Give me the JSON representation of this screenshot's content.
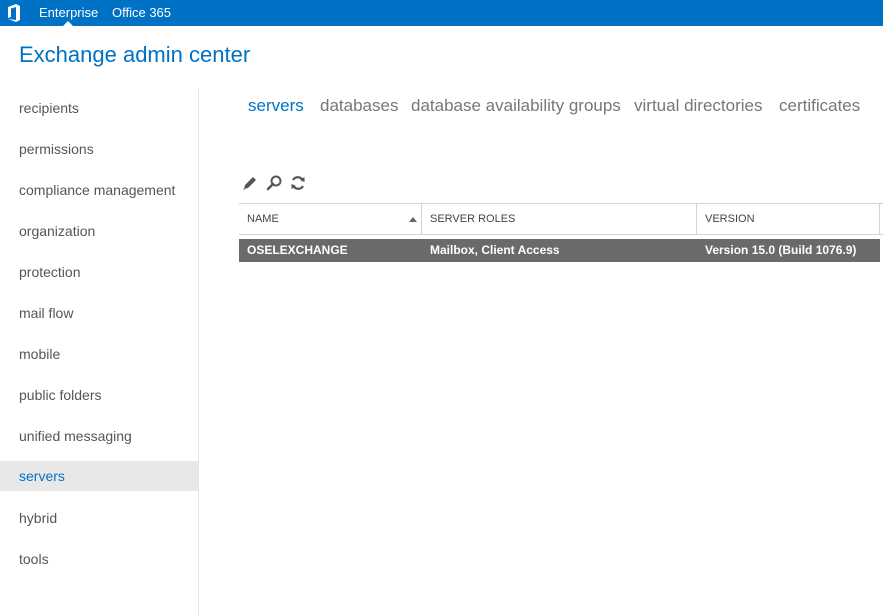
{
  "topbar": {
    "logo_icon": "office-logo-icon",
    "items": [
      {
        "label": "Enterprise"
      },
      {
        "label": "Office 365"
      }
    ],
    "background": "#0072c6"
  },
  "app": {
    "title": "Exchange admin center"
  },
  "sidebar": {
    "items": [
      {
        "label": "recipients"
      },
      {
        "label": "permissions"
      },
      {
        "label": "compliance management"
      },
      {
        "label": "organization"
      },
      {
        "label": "protection"
      },
      {
        "label": "mail flow"
      },
      {
        "label": "mobile"
      },
      {
        "label": "public folders"
      },
      {
        "label": "unified messaging"
      },
      {
        "label": "servers"
      },
      {
        "label": "hybrid"
      },
      {
        "label": "tools"
      }
    ],
    "active": "servers"
  },
  "tabs": [
    {
      "label": "servers"
    },
    {
      "label": "databases"
    },
    {
      "label": "database availability groups"
    },
    {
      "label": "virtual directories"
    },
    {
      "label": "certificates"
    }
  ],
  "toolbar": {
    "icons": [
      "edit-icon",
      "search-icon",
      "refresh-icon"
    ]
  },
  "grid": {
    "columns": [
      "NAME",
      "SERVER ROLES",
      "VERSION"
    ],
    "sort": "ascending",
    "rows": [
      {
        "name": "OSELEXCHANGE",
        "roles": "Mailbox, Client Access",
        "version": "Version 15.0 (Build 1076.9)"
      }
    ],
    "selected_row_color": "#6a6a6a"
  },
  "accent_color": "#0072c6"
}
